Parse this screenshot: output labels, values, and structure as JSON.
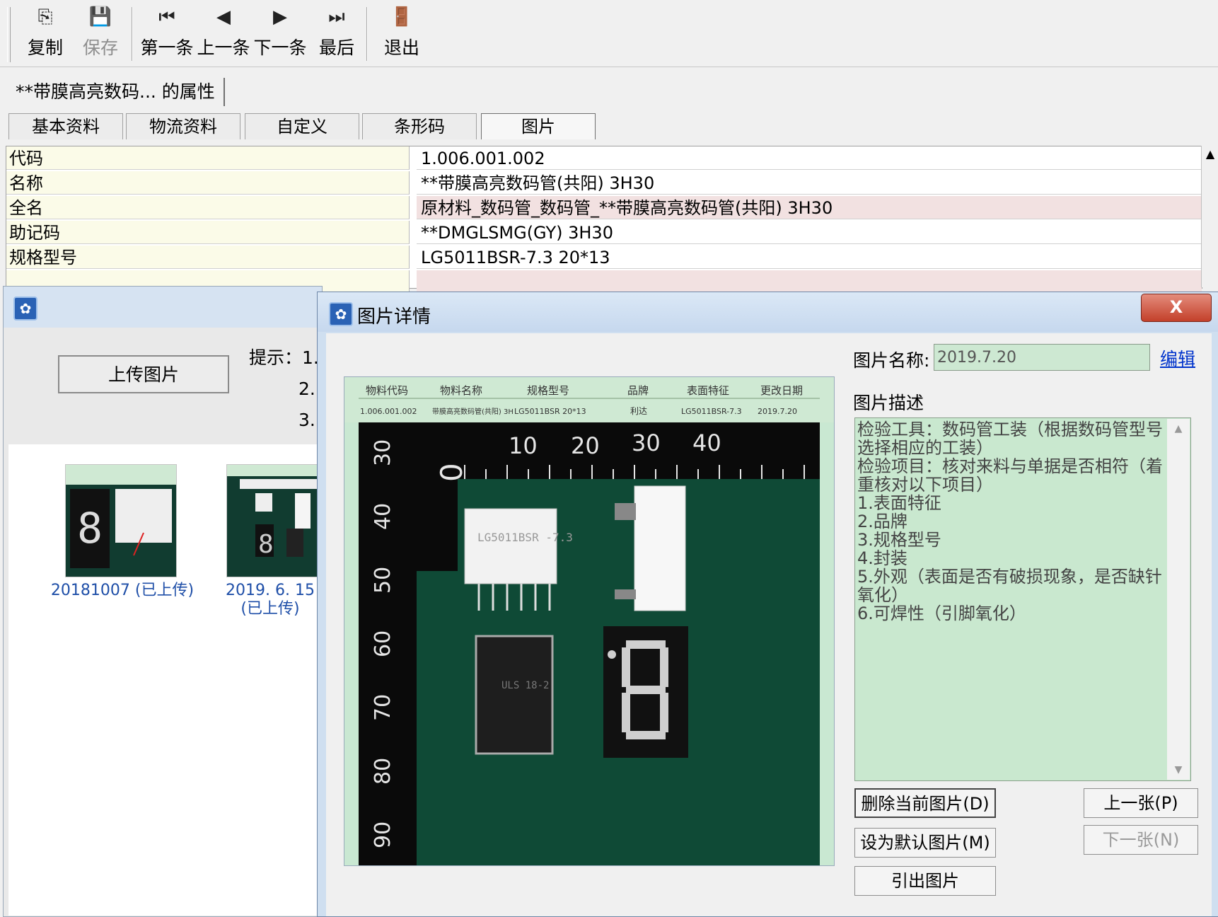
{
  "toolbar": {
    "copy": "复制",
    "save": "保存",
    "first": "第一条",
    "prev": "上一条",
    "next": "下一条",
    "last": "最后",
    "exit": "退出"
  },
  "props": {
    "title": "**带膜高亮数码... 的属性",
    "tabs": [
      "基本资料",
      "物流资料",
      "自定义",
      "条形码",
      "图片"
    ],
    "rows": [
      {
        "k": "代码",
        "v": "1.006.001.002"
      },
      {
        "k": "名称",
        "v": "**带膜高亮数码管(共阳) 3H30"
      },
      {
        "k": "全名",
        "v": "原材料_数码管_数码管_**带膜高亮数码管(共阳) 3H30"
      },
      {
        "k": "助记码",
        "v": "**DMGLSMG(GY) 3H30"
      },
      {
        "k": "规格型号",
        "v": "LG5011BSR-7.3  20*13"
      }
    ]
  },
  "bgdialog": {
    "upload_label": "上传图片",
    "hint": "提示：1.",
    "hint_2": "2.",
    "hint_3": "3.",
    "thumbs": [
      {
        "caption": "20181007 (已上传)"
      },
      {
        "caption": "2019. 6. 15 (已上传)"
      }
    ]
  },
  "dialog": {
    "title": "图片详情",
    "close": "X",
    "name_label": "图片名称:",
    "name_value": "2019.7.20",
    "edit_link": "编辑",
    "desc_label": "图片描述",
    "description": "检验工具：数码管工装（根据数码管型号选择相应的工装）\n检验项目：核对来料与单据是否相符（着重核对以下项目）\n1.表面特征\n2.品牌\n3.规格型号\n4.封装\n5.外观（表面是否有破损现象，是否缺针氧化）\n6.可焊性（引脚氧化）",
    "buttons": {
      "delete": "删除当前图片(D)",
      "set_default": "设为默认图片(M)",
      "export": "引出图片",
      "prev": "上一张(P)",
      "next": "下一张(N)"
    }
  },
  "photo": {
    "header": [
      "物料代码",
      "物料名称",
      "规格型号",
      "品牌",
      "表面特征",
      "更改日期"
    ],
    "values": [
      "1.006.001.002",
      "带膜高亮数码管(共阳) 3H",
      "LG5011BSR  20*13",
      "利达",
      "LG5011BSR-7.3",
      "2019.7.20"
    ],
    "ruler_top": [
      "0",
      "10",
      "20",
      "30",
      "40"
    ],
    "ruler_left": [
      "30",
      "40",
      "50",
      "60",
      "70",
      "80",
      "90"
    ],
    "chip_label": "LG5011BSR\n-7.3",
    "chip2_label": "ULS\n18-2"
  },
  "colors": {
    "board_green": "#0f4a36",
    "form_green": "#c9e8d2",
    "link_blue": "#0033cc"
  }
}
